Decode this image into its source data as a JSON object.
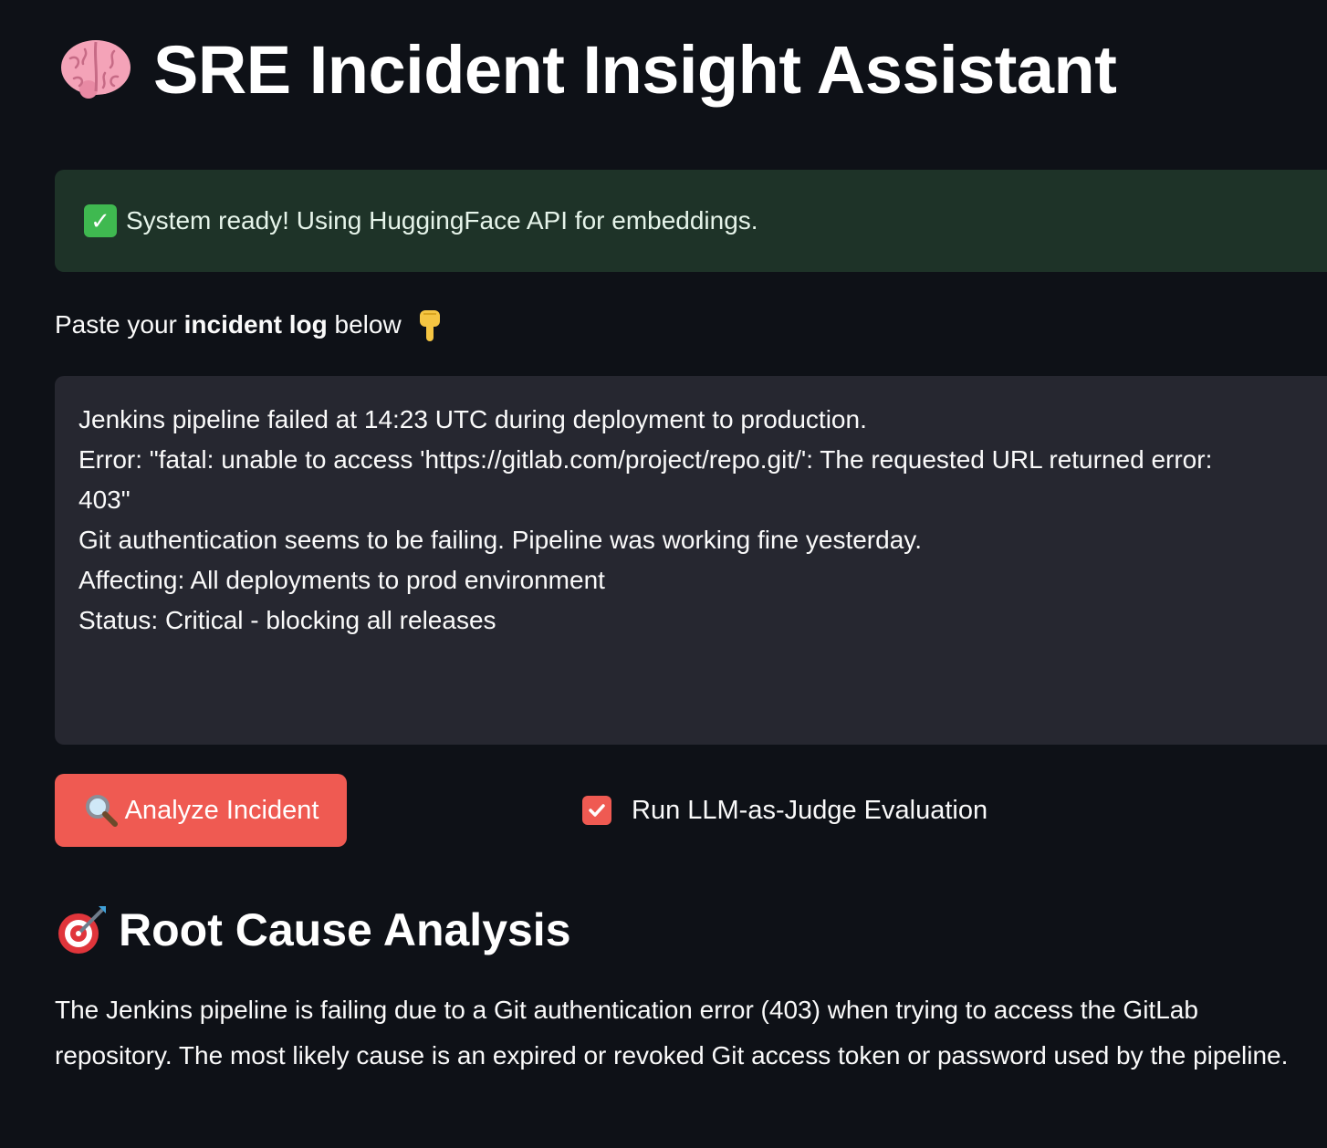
{
  "header": {
    "title": "SRE Incident Insight Assistant",
    "title_icon": "brain-icon"
  },
  "status_alert": {
    "icon": "check-mark-icon",
    "text": "System ready! Using HuggingFace API for embeddings.",
    "color": "#1e3328"
  },
  "input": {
    "prompt_prefix": "Paste your ",
    "prompt_bold": "incident log",
    "prompt_suffix": " below",
    "prompt_icon": "pointing-down-hand-icon",
    "value": "Jenkins pipeline failed at 14:23 UTC during deployment to production.\nError: \"fatal: unable to access 'https://gitlab.com/project/repo.git/': The requested URL returned error: 403\"\nGit authentication seems to be failing. Pipeline was working fine yesterday.\nAffecting: All deployments to prod environment\nStatus: Critical - blocking all releases"
  },
  "actions": {
    "analyze_label": "Analyze Incident",
    "analyze_icon": "magnifying-glass-icon",
    "accent_color": "#ef5a52",
    "judge_checkbox_label": "Run LLM-as-Judge Evaluation",
    "judge_checked": true
  },
  "result": {
    "heading": "Root Cause Analysis",
    "heading_icon": "bullseye-target-icon",
    "body": "The Jenkins pipeline is failing due to a Git authentication error (403) when trying to access the GitLab repository. The most likely cause is an expired or revoked Git access token or password used by the pipeline."
  }
}
